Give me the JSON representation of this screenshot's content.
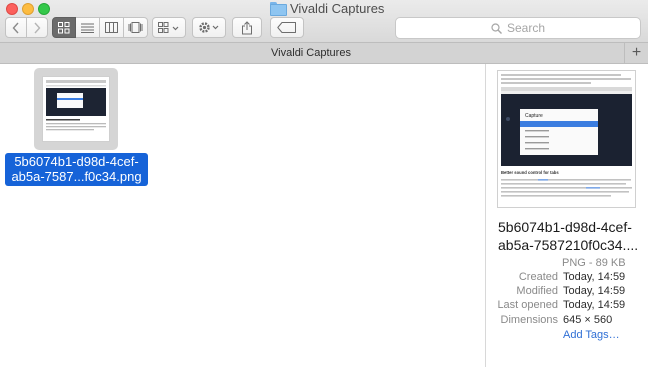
{
  "window": {
    "title": "Vivaldi Captures"
  },
  "toolbar": {
    "search_placeholder": "Search",
    "active_view": "icon"
  },
  "tabbar": {
    "title": "Vivaldi Captures",
    "add_label": "+"
  },
  "file": {
    "name_line1": "5b6074b1-d98d-4cef-",
    "name_line2": "ab5a-7587...f0c34.png"
  },
  "preview": {
    "name_line1": "5b6074b1-d98d-4cef-",
    "name_line2": "ab5a-7587210f0c34....",
    "kind_size": "PNG - 89 KB",
    "meta": [
      {
        "key": "Created",
        "value": "Today, 14:59"
      },
      {
        "key": "Modified",
        "value": "Today, 14:59"
      },
      {
        "key": "Last opened",
        "value": "Today, 14:59"
      },
      {
        "key": "Dimensions",
        "value": "645 × 560"
      }
    ],
    "add_tags": "Add Tags…",
    "image": {
      "capture_heading": "Capture",
      "section_heading": "Better sound control for tabs"
    }
  },
  "colors": {
    "selection": "#1663d8",
    "link": "#2f6fd5"
  }
}
